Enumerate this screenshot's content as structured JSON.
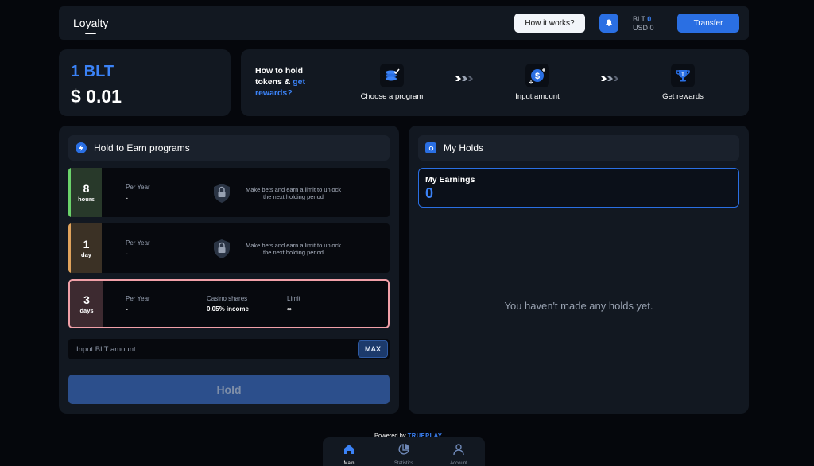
{
  "header": {
    "title": "Loyalty",
    "how_label": "How it works?",
    "balances": [
      {
        "currency": "BLT",
        "value": "0"
      },
      {
        "currency": "USD",
        "value": "0"
      }
    ],
    "transfer_label": "Transfer"
  },
  "price": {
    "token": "1 BLT",
    "usd": "$ 0.01"
  },
  "steps": {
    "title_part1": "How to hold tokens &",
    "title_highlight": "get rewards?",
    "items": [
      {
        "label": "Choose a program",
        "icon": "coins-stack-icon"
      },
      {
        "label": "Input amount",
        "icon": "dollar-coin-icon"
      },
      {
        "label": "Get rewards",
        "icon": "trophy-icon"
      }
    ]
  },
  "programs_panel": {
    "title": "Hold to Earn programs",
    "programs": [
      {
        "amount": "8",
        "unit": "hours",
        "per_year_label": "Per Year",
        "per_year_value": "-",
        "locked": true,
        "message": "Make bets and earn a limit to unlock the next holding period",
        "accent": "#6bd36b"
      },
      {
        "amount": "1",
        "unit": "day",
        "per_year_label": "Per Year",
        "per_year_value": "-",
        "locked": true,
        "message": "Make bets and earn a limit to unlock the next holding period",
        "accent": "#e0a35c"
      },
      {
        "amount": "3",
        "unit": "days",
        "per_year_label": "Per Year",
        "per_year_value": "-",
        "locked": false,
        "shares_label": "Casino shares",
        "shares_value": "0.05% income",
        "limit_label": "Limit",
        "limit_value": "∞",
        "accent": "#f1a0a8"
      }
    ],
    "input_placeholder": "Input BLT amount",
    "max_label": "MAX",
    "hold_label": "Hold"
  },
  "holds_panel": {
    "title": "My Holds",
    "earnings_label": "My Earnings",
    "earnings_value": "0",
    "empty_message": "You haven't made any holds yet."
  },
  "footer": {
    "powered_by": "Powered by",
    "brand": "TRUEPLAY",
    "nav": [
      {
        "label": "Main",
        "icon": "home-icon"
      },
      {
        "label": "Statistics",
        "icon": "pie-chart-icon"
      },
      {
        "label": "Account",
        "icon": "user-icon"
      }
    ]
  },
  "colors": {
    "accent": "#2a6fe3",
    "background": "#05070c",
    "panel": "#121821"
  }
}
